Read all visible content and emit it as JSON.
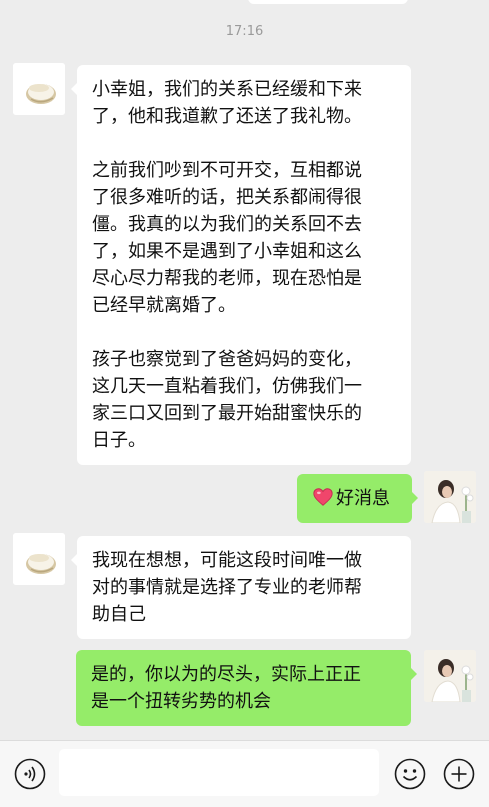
{
  "chat": {
    "timestamp": "17:16",
    "messages": [
      {
        "side": "left",
        "avatar_icon": "coconut-avatar-icon",
        "paragraphs": [
          "小幸姐，我们的关系已经缓和下来\n了，他和我道歉了还送了我礼物。",
          "之前我们吵到不可开交，互相都说\n了很多难听的话，把关系都闹得很\n僵。我真的以为我们的关系回不去\n了，如果不是遇到了小幸姐和这么\n尽心尽力帮我的老师，现在恐怕是\n已经早就离婚了。",
          "孩子也察觉到了爸爸妈妈的变化，\n这几天一直粘着我们，仿佛我们一\n家三口又回到了最开始甜蜜快乐的\n日子。"
        ]
      },
      {
        "side": "right",
        "avatar_icon": "woman-photo-avatar-icon",
        "emoji": "heart-icon",
        "text": "好消息"
      },
      {
        "side": "left",
        "avatar_icon": "coconut-avatar-icon",
        "text": "我现在想想，可能这段时间唯一做\n对的事情就是选择了专业的老师帮\n助自己"
      },
      {
        "side": "right",
        "avatar_icon": "woman-photo-avatar-icon",
        "text": "是的，你以为的尽头，实际上正正\n是一个扭转劣势的机会"
      }
    ]
  },
  "input_bar": {
    "voice_icon": "voice-icon",
    "emoji_icon": "emoji-icon",
    "plus_icon": "plus-icon",
    "message_value": ""
  },
  "colors": {
    "background": "#ededed",
    "incoming_bubble": "#ffffff",
    "outgoing_bubble": "#95ec69",
    "timestamp_text": "#9a9a9a"
  }
}
